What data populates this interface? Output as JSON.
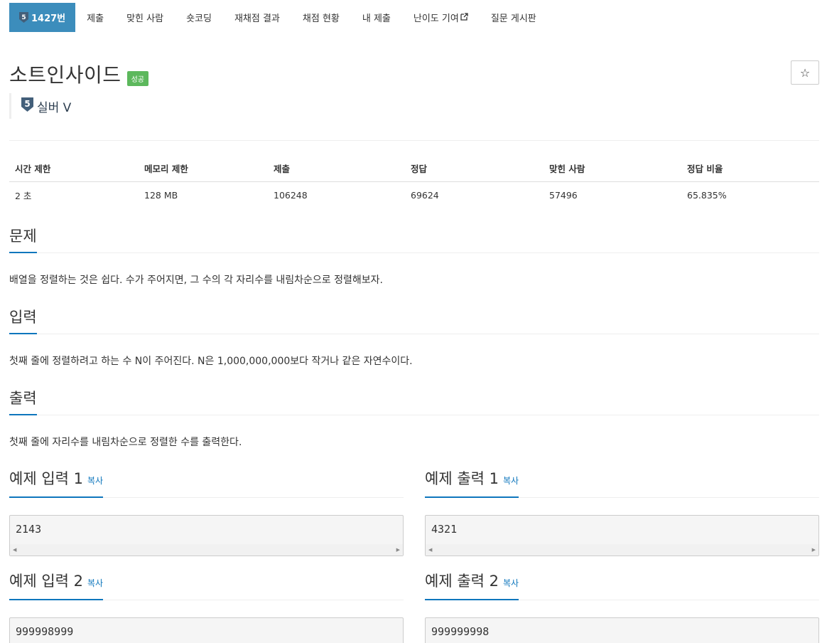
{
  "nav": {
    "problem_id": "1427번",
    "items": [
      "제출",
      "맞힌 사람",
      "숏코딩",
      "재채점 결과",
      "채점 현황",
      "내 제출",
      "난이도 기여",
      "질문 게시판"
    ]
  },
  "problem": {
    "title": "소트인사이드",
    "status_badge": "성공",
    "tier_label": "실버 V",
    "tier_number": "5",
    "star_label": "☆"
  },
  "info_table": {
    "headers": [
      "시간 제한",
      "메모리 제한",
      "제출",
      "정답",
      "맞힌 사람",
      "정답 비율"
    ],
    "values": [
      "2 초",
      "128 MB",
      "106248",
      "69624",
      "57496",
      "65.835%"
    ]
  },
  "sections": {
    "problem": {
      "title": "문제",
      "body": "배열을 정렬하는 것은 쉽다. 수가 주어지면, 그 수의 각 자리수를 내림차순으로 정렬해보자."
    },
    "input": {
      "title": "입력",
      "body": "첫째 줄에 정렬하려고 하는 수 N이 주어진다. N은 1,000,000,000보다 작거나 같은 자연수이다."
    },
    "output": {
      "title": "출력",
      "body": "첫째 줄에 자리수를 내림차순으로 정렬한 수를 출력한다."
    }
  },
  "samples": {
    "copy_label": "복사",
    "input1_title": "예제 입력 1",
    "input1_value": "2143",
    "output1_title": "예제 출력 1",
    "output1_value": "4321",
    "input2_title": "예제 입력 2",
    "input2_value": "999998999",
    "output2_title": "예제 출력 2",
    "output2_value": "999999998"
  },
  "colors": {
    "nav_active": "#3c8dbc",
    "success": "#5cb85c",
    "accent_blue": "#0e76bd",
    "tier_silver": "#435f7a"
  }
}
